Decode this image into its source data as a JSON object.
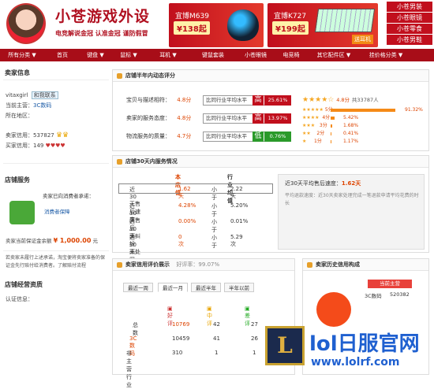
{
  "shop": {
    "title": "小苍游戏外设",
    "subtitle": "电竞解说金冠 认准金冠 谨防假冒"
  },
  "ads": [
    {
      "name": "宜博M639",
      "price": "¥138起"
    },
    {
      "name": "宜博K727",
      "price": "¥199起",
      "note": "送耳机"
    }
  ],
  "side_links": [
    "小苍男装",
    "小苍眼镜",
    "小苍零食",
    "小苍男鞋"
  ],
  "nav": [
    "所有分类 ▼",
    "首页",
    "键盘 ▼",
    "鼠标 ▼",
    "耳机 ▼",
    "键鼠套装",
    "小苍眼镜",
    "电竞椅",
    "其它配件区 ▼",
    "挂价格分类 ▼"
  ],
  "seller_info": {
    "title": "卖家信息",
    "name": "vitaxgirl",
    "contact": "和我联系",
    "main_label": "当前主营：",
    "main_value": "3C数码",
    "loc_label": "所在地区：",
    "credit_label": "卖家信用：",
    "credit_value": "537827",
    "buyer_label": "买家信用：",
    "buyer_value": "149"
  },
  "service": {
    "title": "店铺服务",
    "commit": "卖家已向消费者承诺：",
    "protect": "消费者保障",
    "deposit_label": "卖家当前保证金余额",
    "deposit_value": "¥ 1,000.00",
    "deposit_unit": "元",
    "note": "若卖家未履行上述承诺，淘宝便将卖家准备的保证金先行赔付给消费者。了解赔付流程"
  },
  "ops": {
    "title": "店铺经营资质",
    "cert": "认证信息："
  },
  "half_year": {
    "title": "店铺半年内动态评分",
    "rows": [
      {
        "label": "宝贝与描述相符：",
        "score": "4.8分",
        "cmp": "比同行业平均水平",
        "tag": "高",
        "val": "25.61%"
      },
      {
        "label": "卖家的服务态度：",
        "score": "4.8分",
        "cmp": "比同行业平均水平",
        "tag": "高",
        "val": "13.97%"
      },
      {
        "label": "物流服务的质量：",
        "score": "4.7分",
        "cmp": "比同行业平均水平",
        "tag": "低",
        "val": "0.76%"
      }
    ],
    "avg": "4.8分",
    "total": "共33787人",
    "dist": [
      {
        "label": "5分",
        "pct": "91.32%",
        "v": 91.32
      },
      {
        "label": "4分",
        "pct": "5.42%",
        "v": 5.42
      },
      {
        "label": "3分",
        "pct": "1.68%",
        "v": 1.68
      },
      {
        "label": "2分",
        "pct": "0.41%",
        "v": 0.41
      },
      {
        "label": "1分",
        "pct": "1.17%",
        "v": 1.17
      }
    ]
  },
  "thirty": {
    "title": "店铺30天内服务情况",
    "col_shop": "本店值",
    "col_avg": "行业均值",
    "rows": [
      {
        "label": "近30天售后速度：",
        "shop": "1.62天",
        "cmp": "小于",
        "avg": "2.22天"
      },
      {
        "label": "近30天售后率：",
        "shop": "4.28%",
        "cmp": "小于",
        "avg": "5.20%"
      },
      {
        "label": "近30天纠纷率：",
        "shop": "0.00%",
        "cmp": "小于",
        "avg": "0.01%"
      },
      {
        "label": "近30天处罚数：",
        "shop": "0次",
        "cmp": "小于",
        "avg": "5.29次"
      }
    ],
    "right_head": "近30天平均售后速度：",
    "right_value": "1.62天",
    "right_text": "平均退款速度：近30天卖家处理完成一笔退款申请平均花费的时长"
  },
  "reviews": {
    "title": "卖家信用评价展示",
    "good_rate": "好评率：99.07%",
    "tabs": [
      "最近一周",
      "最近一月",
      "最近半年",
      "半年以前"
    ],
    "cols": [
      "好评",
      "中评",
      "差评"
    ],
    "rows": [
      {
        "label": "总数",
        "good": "10769",
        "mid": "42",
        "bad": "27"
      },
      {
        "label": "3C数码",
        "good": "10459",
        "mid": "41",
        "bad": "26"
      },
      {
        "label": "非主营行业",
        "good": "310",
        "mid": "1",
        "bad": "1"
      }
    ]
  },
  "history": {
    "title": "卖家历史信用构成",
    "main": "当前主营",
    "cat": "3C数码",
    "value": "520382"
  },
  "watermark": {
    "big": "lol日服官网",
    "url": "www.lolrf.com",
    "logo": "L"
  }
}
